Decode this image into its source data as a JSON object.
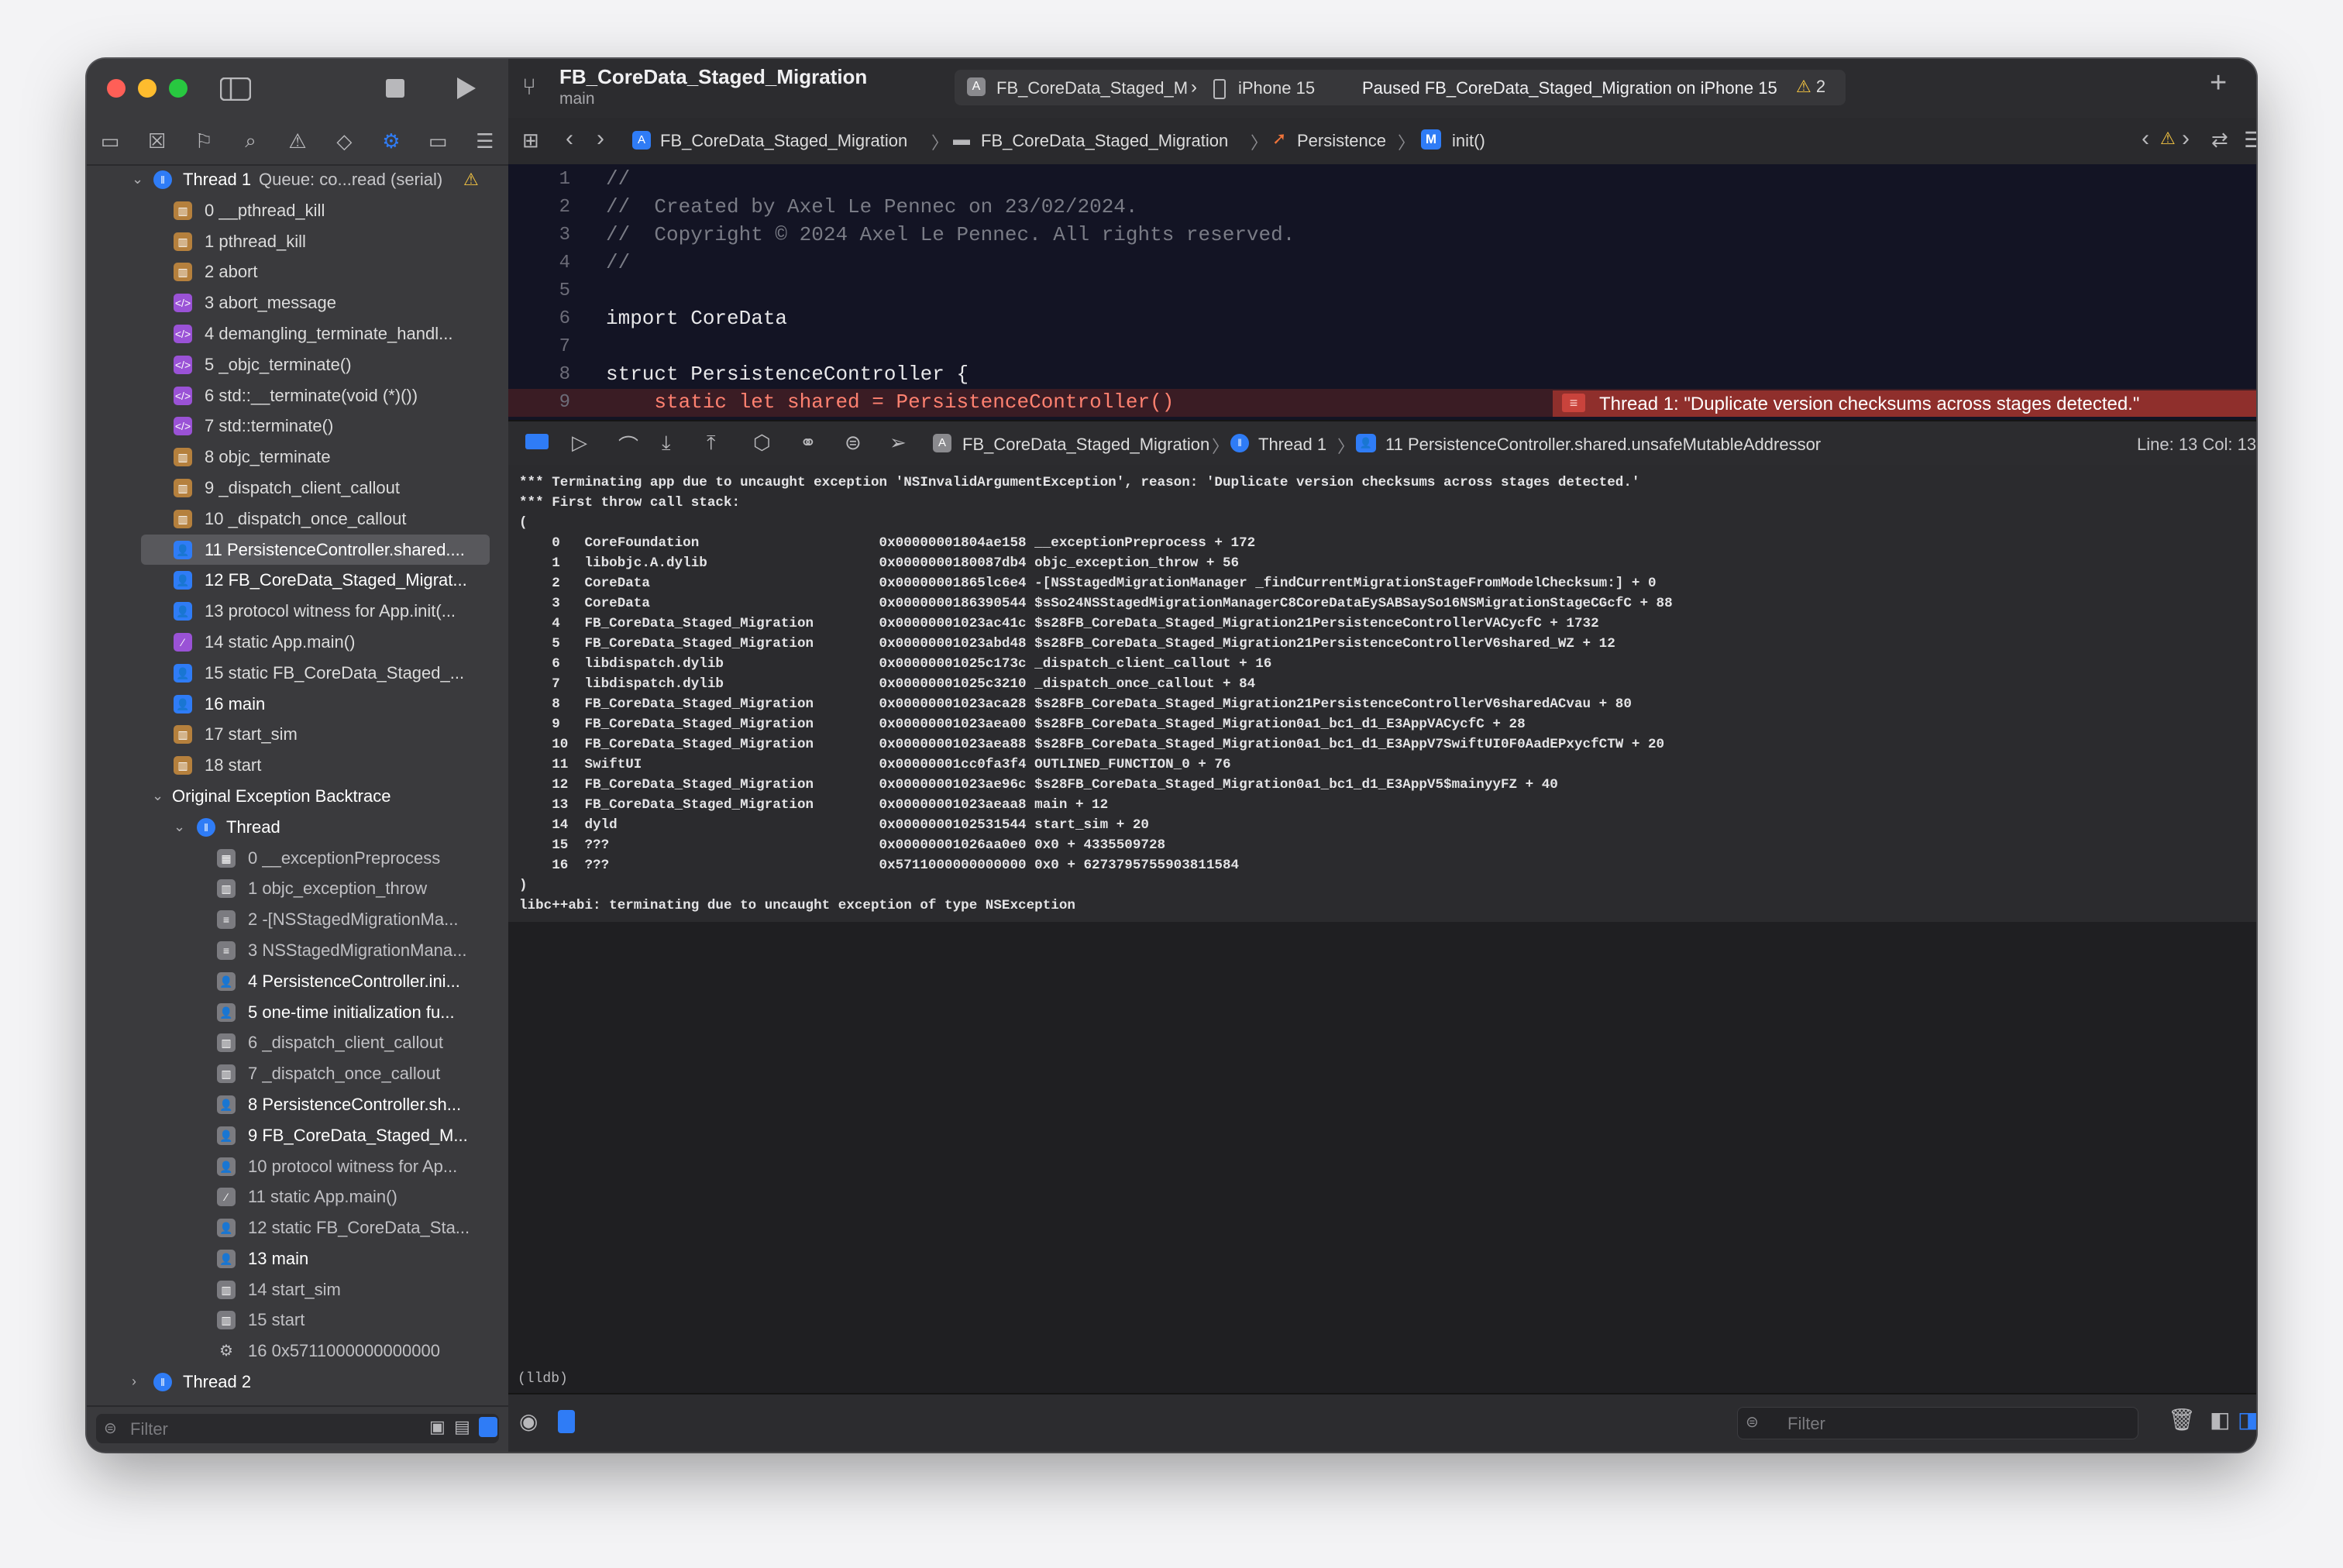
{
  "toolbar": {
    "project": "FB_CoreData_Staged_Migration",
    "branch": "main",
    "scheme": "FB_CoreData_Staged_M",
    "device": "iPhone 15",
    "status": "Paused FB_CoreData_Staged_Migration on iPhone 15",
    "warnings": "2"
  },
  "jumpbar": {
    "crumbs": [
      "FB_CoreData_Staged_Migration",
      "FB_CoreData_Staged_Migration",
      "Persistence",
      "init()"
    ]
  },
  "navigator": {
    "thread1": "Thread 1",
    "thread1_queue": "Queue: co...read (serial)",
    "frames": [
      "0 __pthread_kill",
      "1 pthread_kill",
      "2 abort",
      "3 abort_message",
      "4 demangling_terminate_handl...",
      "5 _objc_terminate()",
      "6 std::__terminate(void (*)())",
      "7 std::terminate()",
      "8 objc_terminate",
      "9 _dispatch_client_callout",
      "10 _dispatch_once_callout",
      "11 PersistenceController.shared....",
      "12 FB_CoreData_Staged_Migrat...",
      "13 protocol witness for App.init(...",
      "14 static App.main()",
      "15 static FB_CoreData_Staged_...",
      "16 main",
      "17 start_sim",
      "18 start"
    ],
    "backtrace_title": "Original Exception Backtrace",
    "backtrace_thread": "Thread",
    "backtrace_frames": [
      "0 __exceptionPreprocess",
      "1 objc_exception_throw",
      "2 -[NSStagedMigrationMa...",
      "3 NSStagedMigrationMana...",
      "4 PersistenceController.ini...",
      "5 one-time initialization fu...",
      "6 _dispatch_client_callout",
      "7 _dispatch_once_callout",
      "8 PersistenceController.sh...",
      "9 FB_CoreData_Staged_M...",
      "10 protocol witness for Ap...",
      "11 static App.main()",
      "12 static FB_CoreData_Sta...",
      "13 main",
      "14 start_sim",
      "15 start",
      "16 0x5711000000000000"
    ],
    "thread2": "Thread 2",
    "filter_placeholder": "Filter"
  },
  "editor": {
    "lines": [
      {
        "n": "1",
        "code": "//"
      },
      {
        "n": "2",
        "code": "//  Created by Axel Le Pennec on 23/02/2024."
      },
      {
        "n": "3",
        "code": "//  Copyright © 2024 Axel Le Pennec. All rights reserved."
      },
      {
        "n": "4",
        "code": "//"
      },
      {
        "n": "5",
        "code": ""
      },
      {
        "n": "6",
        "code": "import CoreData"
      },
      {
        "n": "7",
        "code": ""
      },
      {
        "n": "8",
        "code": "struct PersistenceController {"
      },
      {
        "n": "9",
        "code": "    static let shared = PersistenceController()"
      }
    ],
    "error_banner": "Thread 1: \"Duplicate version checksums across stages detected.\""
  },
  "debugbar": {
    "target": "FB_CoreData_Staged_Migration",
    "thread": "Thread 1",
    "frame": "11 PersistenceController.shared.unsafeMutableAddressor",
    "position": "Line: 13  Col: 13"
  },
  "console": {
    "output": "*** Terminating app due to uncaught exception 'NSInvalidArgumentException', reason: 'Duplicate version checksums across stages detected.'\n*** First throw call stack:\n(\n    0   CoreFoundation                      0x00000001804ae158 __exceptionPreprocess + 172\n    1   libobjc.A.dylib                     0x0000000180087db4 objc_exception_throw + 56\n    2   CoreData                            0x00000001865lc6e4 -[NSStagedMigrationManager _findCurrentMigrationStageFromModelChecksum:] + 0\n    3   CoreData                            0x0000000186390544 $sSo24NSStagedMigrationManagerC8CoreDataEySABSaySo16NSMigrationStageCGcfC + 88\n    4   FB_CoreData_Staged_Migration        0x00000001023ac41c $s28FB_CoreData_Staged_Migration21PersistenceControllerVACycfC + 1732\n    5   FB_CoreData_Staged_Migration        0x00000001023abd48 $s28FB_CoreData_Staged_Migration21PersistenceControllerV6shared_WZ + 12\n    6   libdispatch.dylib                   0x00000001025c173c _dispatch_client_callout + 16\n    7   libdispatch.dylib                   0x00000001025c3210 _dispatch_once_callout + 84\n    8   FB_CoreData_Staged_Migration        0x00000001023aca28 $s28FB_CoreData_Staged_Migration21PersistenceControllerV6sharedACvau + 80\n    9   FB_CoreData_Staged_Migration        0x00000001023aea00 $s28FB_CoreData_Staged_Migration0a1_bc1_d1_E3AppVACycfC + 28\n    10  FB_CoreData_Staged_Migration        0x00000001023aea88 $s28FB_CoreData_Staged_Migration0a1_bc1_d1_E3AppV7SwiftUI0F0AadEPxycfCTW + 20\n    11  SwiftUI                             0x00000001cc0fa3f4 OUTLINED_FUNCTION_0 + 76\n    12  FB_CoreData_Staged_Migration        0x00000001023ae96c $s28FB_CoreData_Staged_Migration0a1_bc1_d1_E3AppV5$mainyyFZ + 40\n    13  FB_CoreData_Staged_Migration        0x00000001023aeaa8 main + 12\n    14  dyld                                0x0000000102531544 start_sim + 20\n    15  ???                                 0x00000001026aa0e0 0x0 + 4335509728\n    16  ???                                 0x5711000000000000 0x0 + 6273795755903811584\n)\nlibc++abi: terminating due to uncaught exception of type NSException",
    "prompt": "(lldb)",
    "filter_placeholder": "Filter"
  },
  "colors": {
    "accent": "#2f7cf6",
    "error": "#e8524a",
    "warning": "#f5c542"
  }
}
